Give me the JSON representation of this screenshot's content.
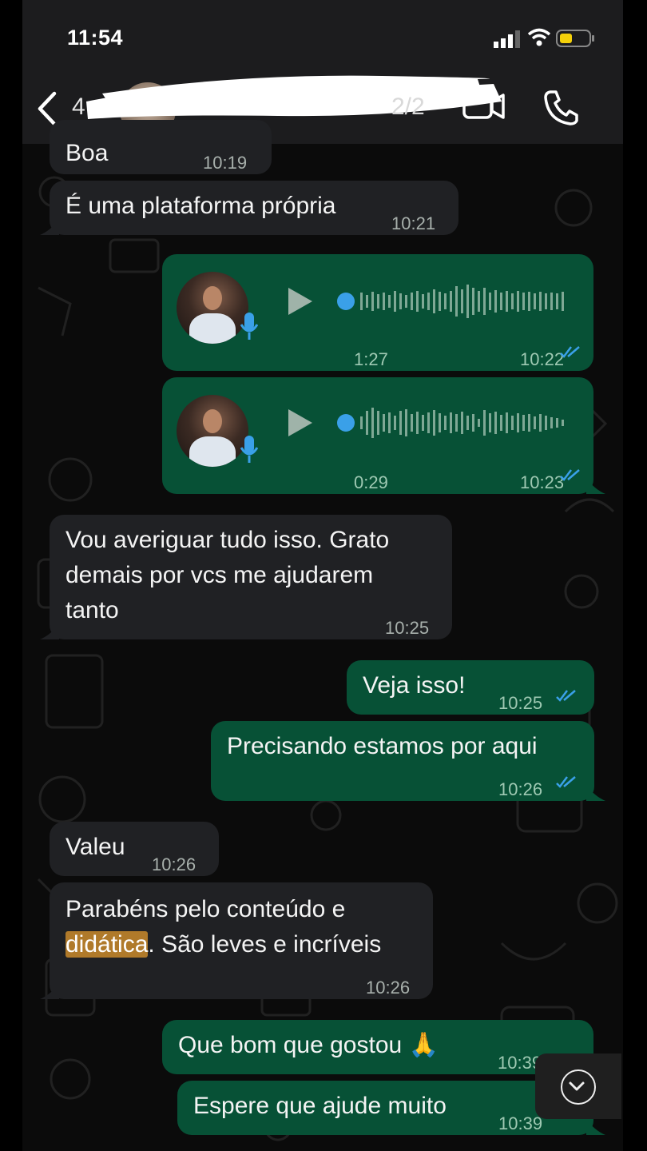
{
  "status": {
    "time": "11:54"
  },
  "header": {
    "partial_left": "4",
    "partial_right": "2/2"
  },
  "messages": [
    {
      "text": "Boa",
      "time": "10:19"
    },
    {
      "text": "É uma plataforma própria",
      "time": "10:21"
    },
    {
      "audio_duration": "1:27",
      "time": "10:22"
    },
    {
      "audio_duration": "0:29",
      "time": "10:23"
    },
    {
      "line1": "Vou averiguar tudo isso. Grato",
      "line2": "demais por vcs me ajudarem",
      "line3": "tanto",
      "time": "10:25"
    },
    {
      "text": "Veja isso!",
      "time": "10:25"
    },
    {
      "text": "Precisando estamos por aqui",
      "time": "10:26"
    },
    {
      "text": "Valeu",
      "time": "10:26"
    },
    {
      "line1": "Parabéns pelo conteúdo e",
      "highlight": "didática",
      "line2_rest": ". São leves e incríveis",
      "time": "10:26"
    },
    {
      "text": "Que bom que gostou",
      "emoji": "🙏",
      "time": "10:39"
    },
    {
      "text": "Espere que ajude muito",
      "time": "10:39"
    }
  ],
  "icons": {
    "back": "chevron-left-icon",
    "video": "video-call-icon",
    "call": "phone-icon",
    "play": "play-icon",
    "mic": "microphone-icon",
    "read": "double-check-icon",
    "scroll": "chevron-down-icon"
  },
  "colors": {
    "outgoing": "#075136",
    "incoming": "#202124",
    "accent": "#3aa0e8",
    "highlight": "#b07a2a"
  }
}
